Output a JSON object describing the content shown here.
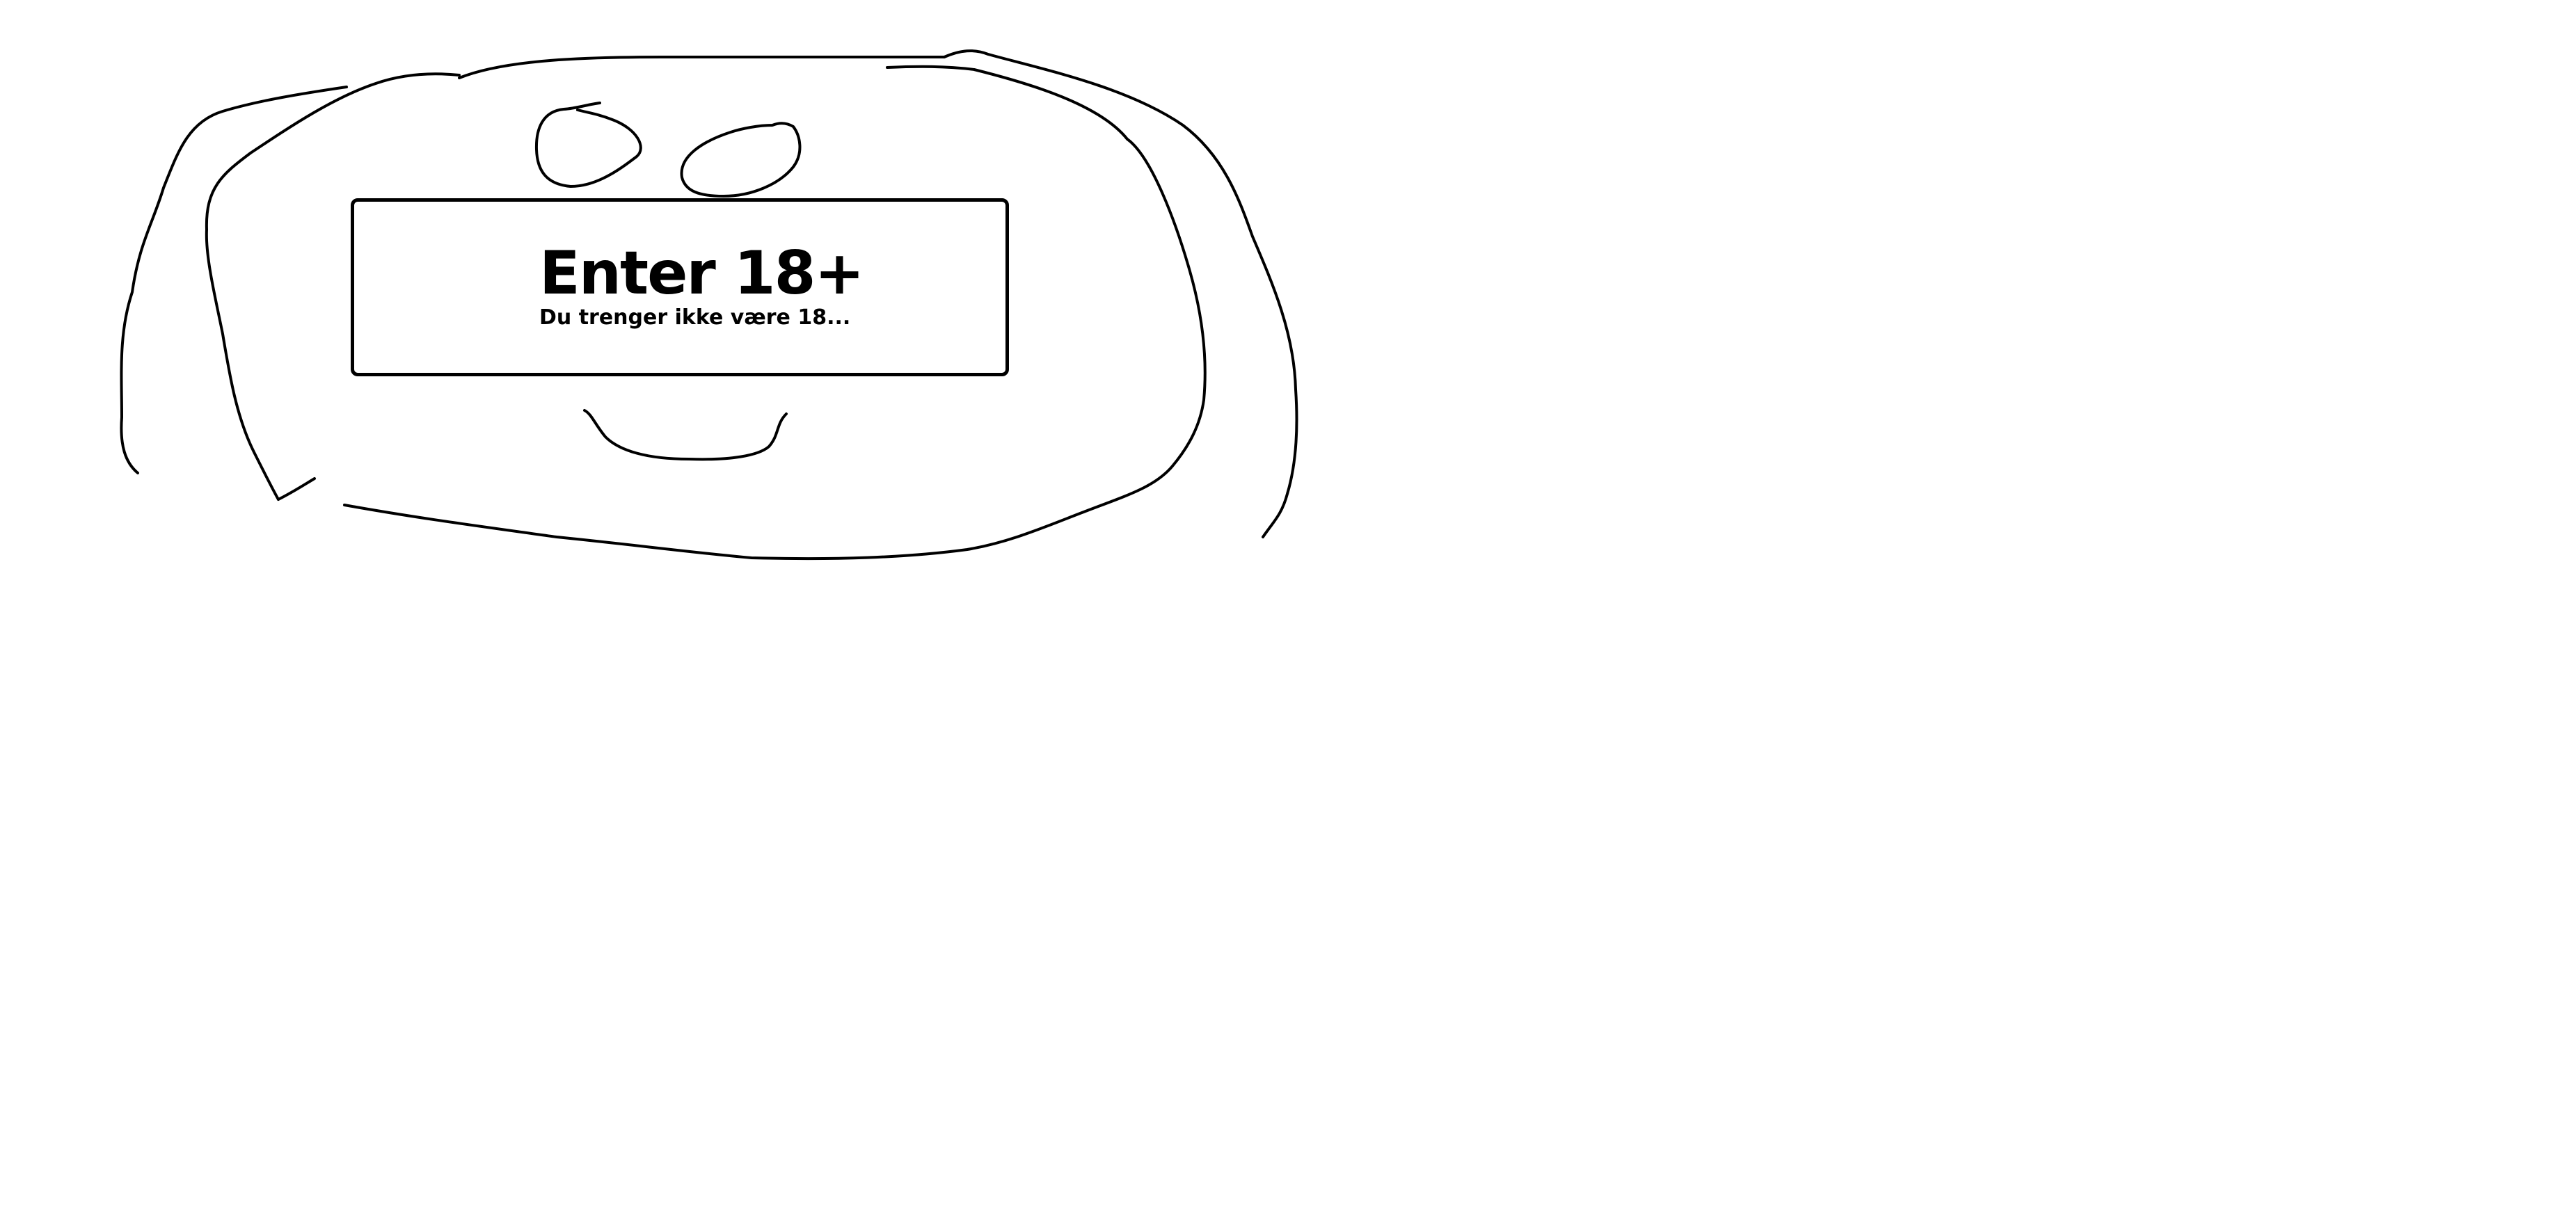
{
  "enter_button": {
    "title": "Enter 18+",
    "subtitle": "Du trenger ikke være 18..."
  },
  "colors": {
    "background": "#ffffff",
    "ink": "#000000"
  }
}
